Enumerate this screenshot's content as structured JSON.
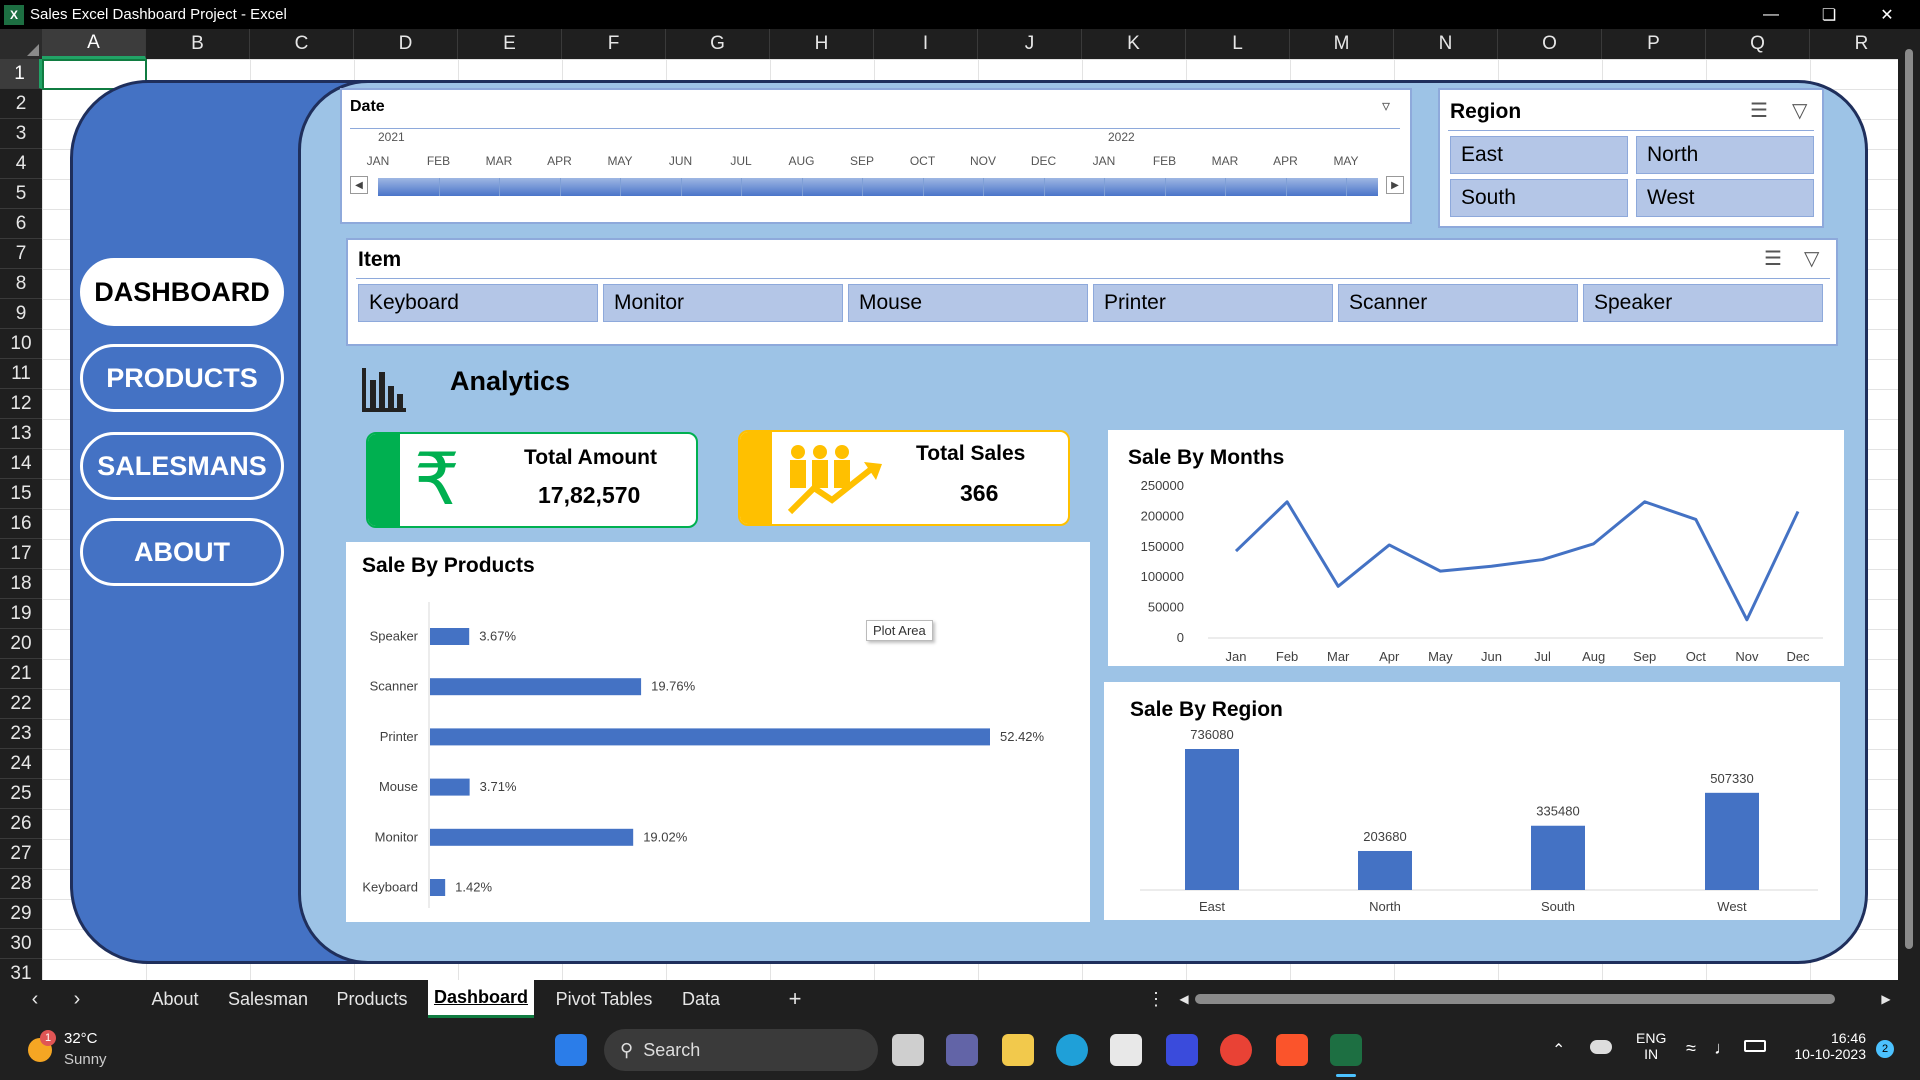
{
  "window": {
    "title": "Sales Excel Dashboard Project - Excel",
    "app_icon": "X"
  },
  "columns": [
    "A",
    "B",
    "C",
    "D",
    "E",
    "F",
    "G",
    "H",
    "I",
    "J",
    "K",
    "L",
    "M",
    "N",
    "O",
    "P",
    "Q",
    "R"
  ],
  "rows": [
    "1",
    "2",
    "3",
    "4",
    "5",
    "6",
    "7",
    "8",
    "9",
    "10",
    "11",
    "12",
    "13",
    "14",
    "15",
    "16",
    "17",
    "18",
    "19",
    "20",
    "21",
    "22",
    "23",
    "24",
    "25",
    "26",
    "27",
    "28",
    "29",
    "30",
    "31"
  ],
  "nav": {
    "dashboard": "DASHBOARD",
    "products": "PRODUCTS",
    "salesmans": "SALESMANS",
    "about": "ABOUT"
  },
  "timeline": {
    "title": "Date",
    "year1": "2021",
    "year2": "2022",
    "months": [
      "JAN",
      "FEB",
      "MAR",
      "APR",
      "MAY",
      "JUN",
      "JUL",
      "AUG",
      "SEP",
      "OCT",
      "NOV",
      "DEC",
      "JAN",
      "FEB",
      "MAR",
      "APR",
      "MAY"
    ]
  },
  "region_slicer": {
    "title": "Region",
    "items": [
      "East",
      "North",
      "South",
      "West"
    ]
  },
  "item_slicer": {
    "title": "Item",
    "items": [
      "Keyboard",
      "Monitor",
      "Mouse",
      "Printer",
      "Scanner",
      "Speaker"
    ]
  },
  "analytics": {
    "title": "Analytics"
  },
  "kpi": {
    "amount_label": "Total Amount",
    "amount_value": "17,82,570",
    "amount_symbol": "₹",
    "sales_label": "Total Sales",
    "sales_value": "366",
    "amount_accent": "#00b050",
    "sales_accent": "#ffc000"
  },
  "tooltip": "Plot Area",
  "chart_data": [
    {
      "type": "bar",
      "title": "Sale By Products",
      "orientation": "horizontal",
      "categories": [
        "Speaker",
        "Scanner",
        "Printer",
        "Mouse",
        "Monitor",
        "Keyboard"
      ],
      "values": [
        3.67,
        19.76,
        52.42,
        3.71,
        19.02,
        1.42
      ],
      "labels": [
        "3.67%",
        "19.76%",
        "52.42%",
        "3.71%",
        "19.02%",
        "1.42%"
      ],
      "color": "#4472c4"
    },
    {
      "type": "line",
      "title": "Sale By Months",
      "categories": [
        "Jan",
        "Feb",
        "Mar",
        "Apr",
        "May",
        "Jun",
        "Jul",
        "Aug",
        "Sep",
        "Oct",
        "Nov",
        "Dec"
      ],
      "values": [
        143000,
        224000,
        85000,
        153000,
        110000,
        118000,
        129000,
        155000,
        224000,
        195000,
        30000,
        208000
      ],
      "y_ticks": [
        "250000",
        "200000",
        "150000",
        "100000",
        "50000",
        "0"
      ],
      "ylim": [
        0,
        250000
      ],
      "color": "#4472c4"
    },
    {
      "type": "bar",
      "title": "Sale By Region",
      "categories": [
        "East",
        "North",
        "South",
        "West"
      ],
      "values": [
        736080,
        203680,
        335480,
        507330
      ],
      "labels": [
        "736080",
        "203680",
        "335480",
        "507330"
      ],
      "color": "#4472c4"
    }
  ],
  "sheet_tabs": [
    "About",
    "Salesman",
    "Products",
    "Dashboard",
    "Pivot Tables",
    "Data"
  ],
  "taskbar": {
    "weather_temp": "32°C",
    "weather_desc": "Sunny",
    "weather_badge": "1",
    "search": "Search",
    "lang1": "ENG",
    "lang2": "IN",
    "time": "16:46",
    "date": "10-10-2023",
    "notif": "2"
  }
}
